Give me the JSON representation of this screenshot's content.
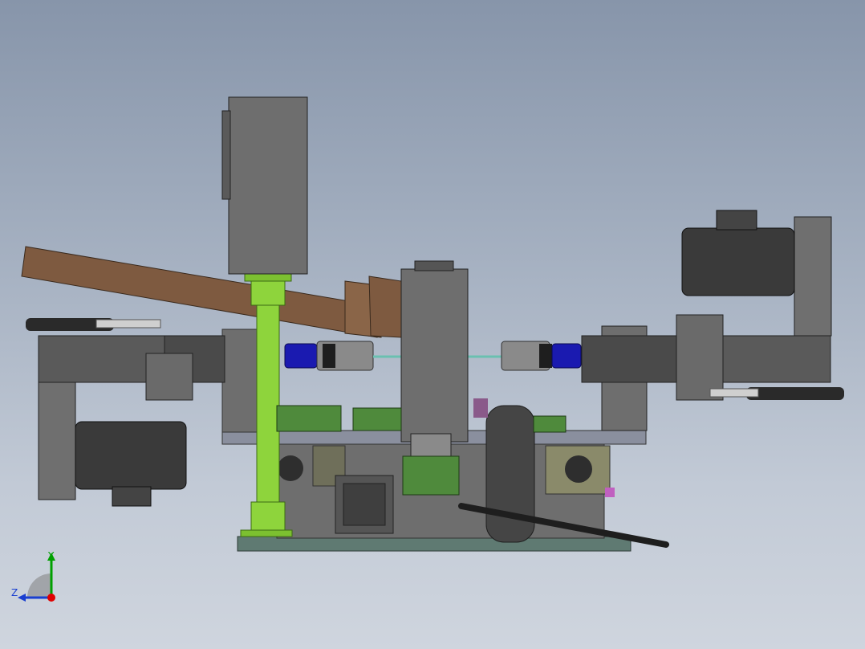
{
  "viewport": {
    "background_top": "#8795aa",
    "background_bottom": "#cfd5de"
  },
  "triad": {
    "y_label": "Y",
    "z_label": "Z",
    "y_color": "#00a000",
    "z_color": "#1a3fd0",
    "x_color": "#e00000"
  },
  "model_colors": {
    "frame_gray": "#6e6e6e",
    "dark_gray": "#4a4a4a",
    "green_column": "#8ed43c",
    "brown_chute": "#7e5a40",
    "blue_coupling": "#1a1ab0",
    "pcb_green": "#4f8a3c",
    "base_plate": "#5f7a72"
  },
  "icons": {
    "triad": "axis-triad-icon"
  }
}
